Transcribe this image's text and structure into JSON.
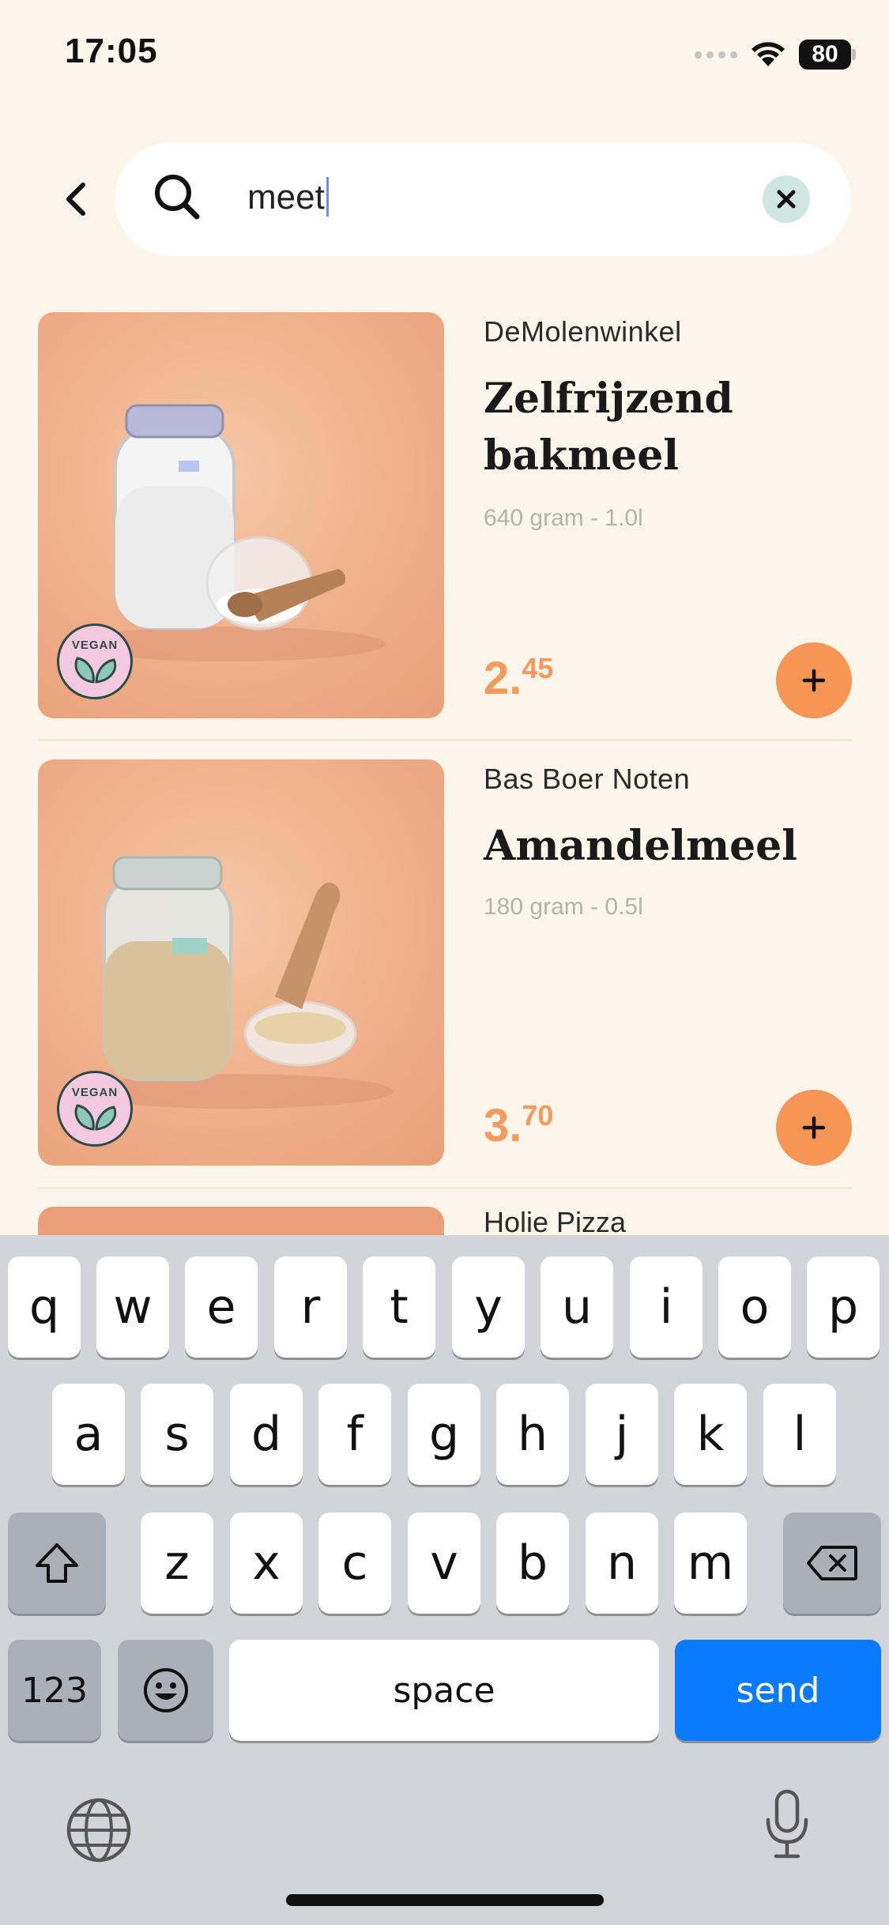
{
  "status_bar": {
    "time": "17:05",
    "battery": "80"
  },
  "search": {
    "query": "meet"
  },
  "products": [
    {
      "vendor": "DeMolenwinkel",
      "title": "Zelfrijzend bakmeel",
      "size": "640 gram - 1.0l",
      "price_main": "2.",
      "price_cents": "45",
      "badge": "VEGAN"
    },
    {
      "vendor": "Bas Boer Noten",
      "title": "Amandelmeel",
      "size": "180 gram - 0.5l",
      "price_main": "3.",
      "price_cents": "70",
      "badge": "VEGAN"
    },
    {
      "vendor": "Holie Pizza"
    }
  ],
  "keyboard": {
    "row1": [
      "q",
      "w",
      "e",
      "r",
      "t",
      "y",
      "u",
      "i",
      "o",
      "p"
    ],
    "row2": [
      "a",
      "s",
      "d",
      "f",
      "g",
      "h",
      "j",
      "k",
      "l"
    ],
    "row3": [
      "z",
      "x",
      "c",
      "v",
      "b",
      "n",
      "m"
    ],
    "numbers_label": "123",
    "space_label": "space",
    "send_label": "send"
  },
  "colors": {
    "background": "#fcf6ea",
    "accent": "#f59657",
    "send": "#0a7aff"
  }
}
